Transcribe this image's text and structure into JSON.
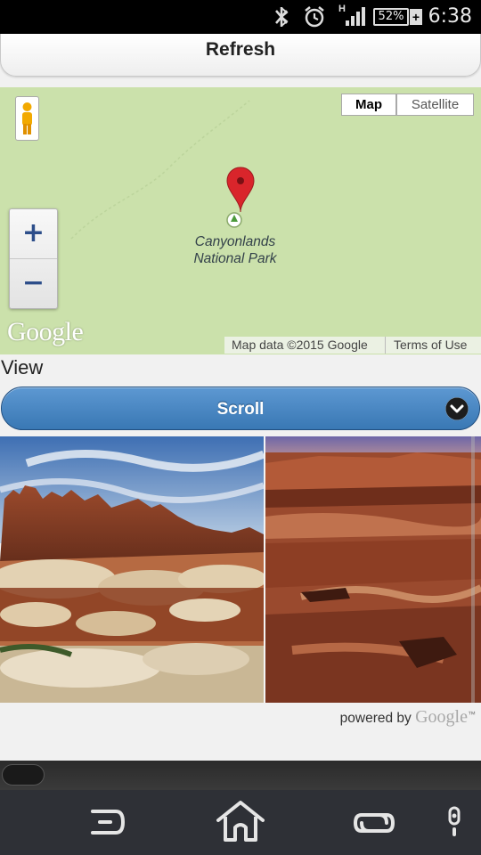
{
  "status_bar": {
    "icons": [
      "bluetooth-off-icon",
      "alarm-icon",
      "hspa-signal-icon",
      "battery-icon"
    ],
    "network": "H",
    "battery": "52%",
    "charging": "+",
    "time": "6:38"
  },
  "toolbar": {
    "refresh_label": "Refresh"
  },
  "map": {
    "type_controls": {
      "map": "Map",
      "satellite": "Satellite",
      "selected": "Map"
    },
    "zoom": {
      "in": "+",
      "out": "−"
    },
    "marker_label_line1": "Canyonlands",
    "marker_label_line2": "National Park",
    "logo": "Google",
    "attribution": "Map data ©2015 Google",
    "terms": "Terms of Use",
    "colors": {
      "land": "#cbe1ab",
      "marker": "#d9252b"
    }
  },
  "view": {
    "label": "View",
    "select_value": "Scroll"
  },
  "photos": {
    "items": [
      "canyonlands-needles-photo",
      "canyonlands-island-in-the-sky-photo"
    ],
    "powered_by": "powered by",
    "powered_by_brand": "Google",
    "powered_by_tm": "™"
  },
  "nav_bar": {
    "buttons": [
      "back-icon",
      "home-icon",
      "recent-apps-icon",
      "menu-icon"
    ]
  }
}
